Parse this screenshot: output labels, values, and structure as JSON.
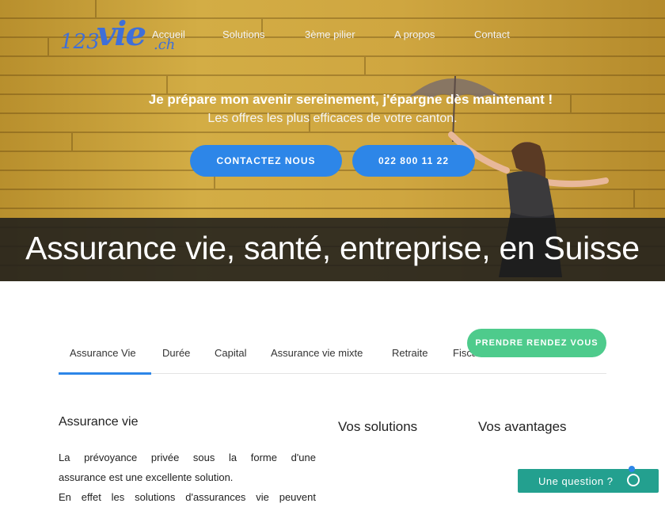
{
  "logo": {
    "number": "123",
    "word": "vie",
    "tld": ".ch"
  },
  "nav": {
    "items": [
      "Accueil",
      "Solutions",
      "3ème pilier",
      "A propos",
      "Contact"
    ]
  },
  "hero": {
    "title": "Je prépare mon avenir sereinement, j'épargne dès maintenant !",
    "subtitle": "Les offres les plus efficaces de votre canton.",
    "buttons": {
      "contact": "CONTACTEZ NOUS",
      "phone": "022 800 11 22"
    }
  },
  "banner": {
    "title": "Assurance vie, santé, entreprise, en Suisse"
  },
  "tabs": [
    "Assurance Vie",
    "Durée",
    "Capital",
    "Assurance vie mixte",
    "Retraite",
    "Fiscalité"
  ],
  "active_tab": "Assurance Vie",
  "cta": {
    "appointment": "PRENDRE RENDEZ VOUS"
  },
  "content": {
    "left_title": "Assurance vie",
    "left_lines": [
      "La prévoyance privée sous la forme d'une",
      "assurance est une excellente solution.",
      "En effet les solutions d'assurances vie peuvent"
    ],
    "middle_title": "Vos solutions",
    "right_title": "Vos avantages"
  },
  "chat": {
    "label": "Une question ?",
    "icon": "whatsapp-icon"
  },
  "colors": {
    "primary_blue": "#2d86e8",
    "green": "#4ecb8c",
    "teal": "#23a08f",
    "wall_yellow": "#c9a23a"
  }
}
